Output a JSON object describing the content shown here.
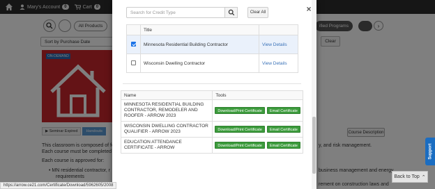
{
  "topbar": {
    "account_label": "Mary's Account",
    "account_count": "0",
    "cart_label": "Cart",
    "cart_count": "0"
  },
  "filters": {
    "all_products": "All Products",
    "certified_programs": "ified Programs",
    "sort_value": "Sort by Purchase Date",
    "clear": "Clear"
  },
  "course": {
    "thumb_tag": "ON-DEMAND",
    "tabs": [
      "Seminar Expired",
      "Handouts"
    ],
    "course_description": "Course Description"
  },
  "background_text": {
    "line1_left": "This classroom is composed of fo",
    "line1_right": "y, and risk management.",
    "line2_left": "Each course must be completed b",
    "line3": "Each course is approved for:",
    "bullet1_left": "MN residential contractor, r",
    "bullet1_right": "business management and energy",
    "bullet1_cont": "requirements",
    "bullet2_right": "rement on construction laws and"
  },
  "modal": {
    "search_placeholder": "Search for Credit Type",
    "clear_all": "Clear All",
    "credit_table": {
      "title_header": "Title",
      "rows": [
        {
          "title": "Minnesota Residential Building Contractor",
          "link": "View Details",
          "checked": true
        },
        {
          "title": "Wisconsin Dwelling Contractor",
          "link": "View Details",
          "checked": false
        }
      ]
    },
    "cert_table": {
      "name_header": "Name",
      "tools_header": "Tools",
      "download_label": "Download/Print Certificate",
      "email_label": "Email Certificate",
      "rows": [
        {
          "name": "MINNESOTA RESIDENTIAL BUILDING CONTRACTOR, REMODELER AND ROOFER - ARROW 2023"
        },
        {
          "name": "WISCONSIN DWELLING CONTRACTOR QUALIFIER - ARROW 2023"
        },
        {
          "name": "EDUCATION ATTENDANCE CERTIFICATE - ARROW"
        }
      ]
    }
  },
  "status_url": "https://arrow.ce21.com/Certificate/Download/5962605/2008",
  "back_to_top": "Back to Top",
  "support": "Support",
  "colors": {
    "accent_green": "#3c9b3c",
    "link_blue": "#3a72b8",
    "thumb_red": "#c9262c",
    "support_blue": "#1b6dc1"
  }
}
